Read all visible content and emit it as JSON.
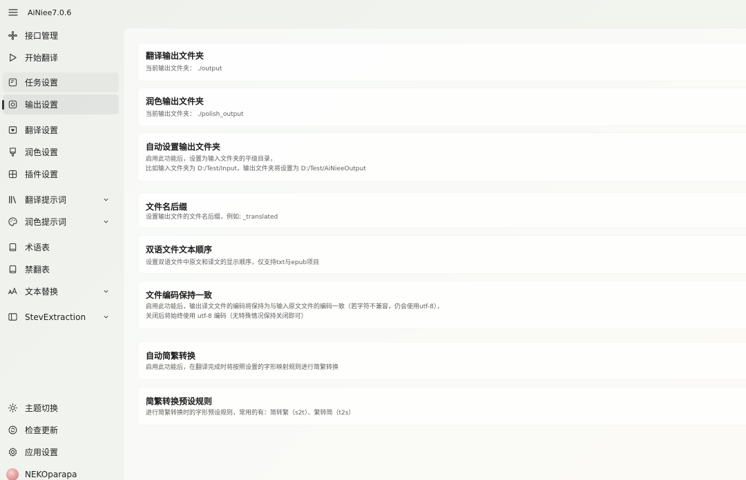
{
  "app": {
    "title": "AiNiee7.0.6"
  },
  "sidebar": {
    "items": [
      {
        "label": "接口管理",
        "icon": "fan-icon"
      },
      {
        "label": "开始翻译",
        "icon": "play-icon"
      },
      {
        "label": "任务设置",
        "icon": "task-icon"
      },
      {
        "label": "输出设置",
        "icon": "output-icon"
      },
      {
        "label": "翻译设置",
        "icon": "heart-book-icon"
      },
      {
        "label": "润色设置",
        "icon": "brush-icon"
      },
      {
        "label": "插件设置",
        "icon": "plugin-icon"
      },
      {
        "label": "翻译提示词",
        "icon": "library-icon"
      },
      {
        "label": "润色提示词",
        "icon": "palette-icon"
      },
      {
        "label": "术语表",
        "icon": "book-icon"
      },
      {
        "label": "禁翻表",
        "icon": "book-icon"
      },
      {
        "label": "文本替换",
        "icon": "font-size-icon"
      },
      {
        "label": "StevExtraction",
        "icon": "extraction-icon"
      }
    ],
    "bottom": [
      {
        "label": "主题切换",
        "icon": "sun-icon"
      },
      {
        "label": "检查更新",
        "icon": "update-icon"
      },
      {
        "label": "应用设置",
        "icon": "settings-icon"
      },
      {
        "label": "NEKOparapa",
        "icon": "avatar"
      }
    ]
  },
  "cards": [
    {
      "title": "翻译输出文件夹",
      "desc": [
        "当前输出文件夹： ./output"
      ]
    },
    {
      "title": "润色输出文件夹",
      "desc": [
        "当前输出文件夹： ./polish_output"
      ]
    },
    {
      "title": "自动设置输出文件夹",
      "desc": [
        "启用此功能后，设置为输入文件夹的平级目录，",
        "比如输入文件夹为 D:/Test/Input，输出文件夹将设置为 D:/Test/AiNieeOutput"
      ]
    },
    {
      "title": "文件名后缀",
      "desc": [
        "设置输出文件的文件名后缀，例如: _translated"
      ]
    },
    {
      "title": "双语文件文本顺序",
      "desc": [
        "设置双语文件中原文和译文的显示顺序，仅支持txt与epub项目"
      ]
    },
    {
      "title": "文件编码保持一致",
      "desc": [
        "启用此功能后，输出译文文件的编码将保持为与输入原文文件的编码一致（若字符不兼容，仍会使用utf-8），",
        "关闭后将始终使用 utf-8 编码（无特殊情况保持关闭即可）"
      ]
    },
    {
      "title": "自动简繁转换",
      "desc": [
        "启用此功能后，在翻译完成时将按照设置的字形映射规则进行简繁转换"
      ]
    },
    {
      "title": "简繁转换预设规则",
      "desc": [
        "进行简繁转换时的字形预设规则，常用的有：简转繁（s2t）、繁转简（t2s）"
      ]
    }
  ]
}
